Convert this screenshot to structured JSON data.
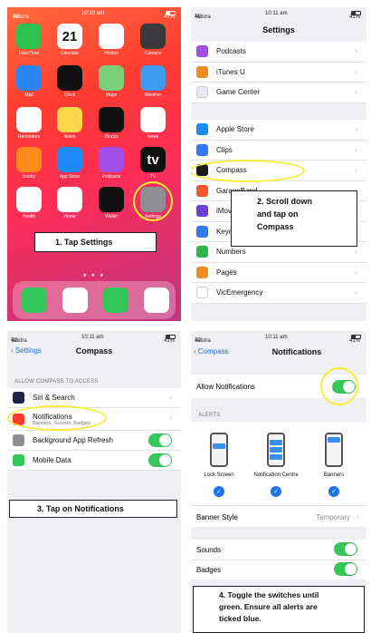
{
  "panel1": {
    "status": {
      "carrier": "Telstra",
      "network": "4G",
      "time": "10:10 am",
      "battery": "42%"
    },
    "apps": [
      {
        "label": "FaceTime",
        "icon": "facetime-icon",
        "color": "#2fc14e"
      },
      {
        "label": "Calendar",
        "icon": "calendar-icon",
        "color": "#ffffff",
        "text": "21"
      },
      {
        "label": "Photos",
        "icon": "photos-icon",
        "color": "#ffffff"
      },
      {
        "label": "Camera",
        "icon": "camera-icon",
        "color": "#3a3a3c"
      },
      {
        "label": "Mail",
        "icon": "mail-icon",
        "color": "#2b86f5"
      },
      {
        "label": "Clock",
        "icon": "clock-icon",
        "color": "#111111"
      },
      {
        "label": "Maps",
        "icon": "maps-icon",
        "color": "#7ccf7a"
      },
      {
        "label": "Weather",
        "icon": "weather-icon",
        "color": "#3d9bf0"
      },
      {
        "label": "Reminders",
        "icon": "reminders-icon",
        "color": "#ffffff"
      },
      {
        "label": "Notes",
        "icon": "notes-icon",
        "color": "#ffd84a"
      },
      {
        "label": "Stocks",
        "icon": "stocks-icon",
        "color": "#111111"
      },
      {
        "label": "News",
        "icon": "news-icon",
        "color": "#ffffff"
      },
      {
        "label": "Books",
        "icon": "books-icon",
        "color": "#ff8a1c"
      },
      {
        "label": "App Store",
        "icon": "app-store-icon",
        "color": "#1d8cf8"
      },
      {
        "label": "Podcasts",
        "icon": "podcasts-icon",
        "color": "#a24ee8"
      },
      {
        "label": "TV",
        "icon": "tv-icon",
        "color": "#111111",
        "text": "tv"
      },
      {
        "label": "Health",
        "icon": "health-icon",
        "color": "#ffffff"
      },
      {
        "label": "Home",
        "icon": "home-icon",
        "color": "#ffffff"
      },
      {
        "label": "Wallet",
        "icon": "wallet-icon",
        "color": "#111111"
      },
      {
        "label": "Settings",
        "icon": "settings-icon",
        "color": "#8e8e93"
      }
    ],
    "dock": [
      {
        "icon": "phone-icon",
        "color": "#33c659"
      },
      {
        "icon": "safari-icon",
        "color": "#ffffff"
      },
      {
        "icon": "messages-icon",
        "color": "#33c659"
      },
      {
        "icon": "music-icon",
        "color": "#ffffff"
      }
    ],
    "callout": "1.    Tap Settings"
  },
  "panel2": {
    "status": {
      "carrier": "Telstra",
      "network": "4G",
      "time": "10:11 am",
      "battery": "41%"
    },
    "title": "Settings",
    "group1": [
      {
        "label": "Podcasts",
        "icon": "podcasts-icon",
        "color": "#a24ee8"
      },
      {
        "label": "iTunes U",
        "icon": "itunes-u-icon",
        "color": "#f08a24"
      },
      {
        "label": "Game Center",
        "icon": "game-center-icon",
        "color": "#e8e8ee"
      }
    ],
    "group2": [
      {
        "label": "Apple Store",
        "icon": "apple-store-icon",
        "color": "#1a8cf5"
      },
      {
        "label": "Clips",
        "icon": "clips-icon",
        "color": "#3478f6"
      },
      {
        "label": "Compass",
        "icon": "compass-icon",
        "color": "#1c1c1e"
      },
      {
        "label": "GarageBand",
        "icon": "garageband-icon",
        "color": "#f05a28"
      },
      {
        "label": "iMovie",
        "icon": "imovie-icon",
        "color": "#6a3fd6"
      },
      {
        "label": "Keynote",
        "icon": "keynote-icon",
        "color": "#2f7cf6"
      },
      {
        "label": "Numbers",
        "icon": "numbers-icon",
        "color": "#2fb34a"
      },
      {
        "label": "Pages",
        "icon": "pages-icon",
        "color": "#f08a24"
      },
      {
        "label": "VicEmergency",
        "icon": "vicemergency-icon",
        "color": "#ffffff"
      }
    ],
    "callout": [
      "2.    Scroll down",
      "and tap on",
      "Compass"
    ]
  },
  "panel3": {
    "status": {
      "carrier": "Telstra",
      "network": "4G",
      "time": "10:11 am",
      "battery": "41%"
    },
    "back": "Settings",
    "title": "Compass",
    "section": "ALLOW COMPASS TO ACCESS",
    "rows": [
      {
        "label": "Siri & Search",
        "icon": "siri-icon",
        "color": "#222244",
        "control": "chevron"
      },
      {
        "label": "Notifications",
        "sub": "Banners, Sounds, Badges",
        "icon": "notifications-icon",
        "color": "#ff3b30",
        "control": "chevron"
      },
      {
        "label": "Background App Refresh",
        "icon": "gear-icon",
        "color": "#8e8e93",
        "control": "toggle",
        "on": true
      },
      {
        "label": "Mobile Data",
        "icon": "mobile-data-icon",
        "color": "#35c759",
        "control": "toggle",
        "on": true
      }
    ],
    "callout": "3.    Tap on Notifications"
  },
  "panel4": {
    "status": {
      "carrier": "Telstra",
      "network": "4G",
      "time": "10:11 am",
      "battery": "41%"
    },
    "back": "Compass",
    "title": "Notifications",
    "allow_label": "Allow Notifications",
    "alerts_section": "ALERTS",
    "alert_options": [
      "Lock Screen",
      "Notification Centre",
      "Banners"
    ],
    "banner_style_label": "Banner Style",
    "banner_style_value": "Temporary",
    "sounds_label": "Sounds",
    "badges_label": "Badges",
    "callout": [
      "4.    Toggle the switches until",
      "green. Ensure all alerts are",
      "ticked blue."
    ]
  },
  "colors": {
    "toggle_on": "#35c759",
    "ios_blue": "#1a73e8",
    "highlight": "#f7ec3a"
  }
}
